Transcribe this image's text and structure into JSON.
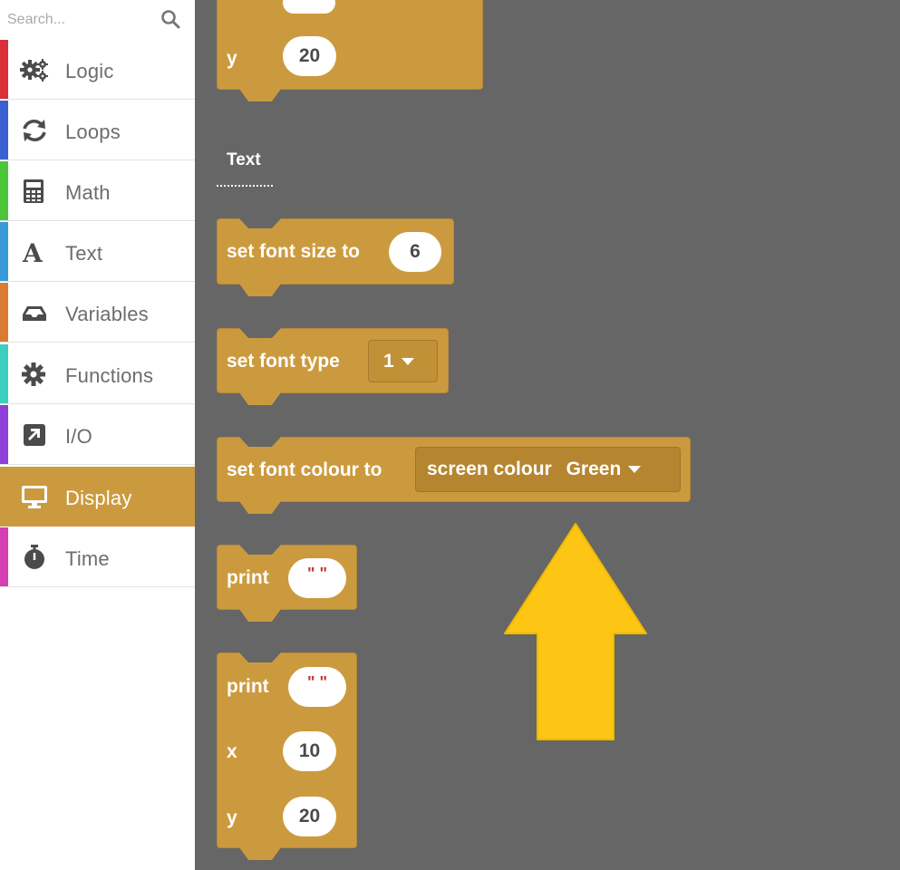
{
  "search": {
    "placeholder": "Search..."
  },
  "sidebar": {
    "items": [
      {
        "label": "Logic",
        "icon": "gears-icon",
        "color": "#d9303a"
      },
      {
        "label": "Loops",
        "icon": "refresh-icon",
        "color": "#3b5fd3"
      },
      {
        "label": "Math",
        "icon": "calculator-icon",
        "color": "#4cc53a"
      },
      {
        "label": "Text",
        "icon": "text-a-icon",
        "color": "#3a9ad9"
      },
      {
        "label": "Variables",
        "icon": "inbox-icon",
        "color": "#db7a33"
      },
      {
        "label": "Functions",
        "icon": "gear-icon",
        "color": "#3ccfc0"
      },
      {
        "label": "I/O",
        "icon": "external-link-icon",
        "color": "#8e3fd9"
      },
      {
        "label": "Display",
        "icon": "monitor-icon",
        "color": "#cc9a3e",
        "active": true
      },
      {
        "label": "Time",
        "icon": "stopwatch-icon",
        "color": "#d63fb3"
      }
    ]
  },
  "workspace": {
    "section_label": "Text",
    "top_block": {
      "y_label": "y",
      "y_value": "20"
    },
    "font_size_block": {
      "label": "set font size to",
      "value": "6"
    },
    "font_type_block": {
      "label": "set font type",
      "value": "1"
    },
    "font_colour_block": {
      "label": "set font colour to",
      "value_prefix": "screen colour",
      "value": "Green"
    },
    "print_block": {
      "label": "print",
      "value": "\" \""
    },
    "print_xy_block": {
      "label": "print",
      "value": "\" \"",
      "x_label": "x",
      "x_value": "10",
      "y_label": "y",
      "y_value": "20"
    }
  },
  "colors": {
    "block": "#cc9a3e",
    "workspace": "#666666",
    "arrow": "#fdc514",
    "sidebar_text": "#6d6d6d"
  }
}
